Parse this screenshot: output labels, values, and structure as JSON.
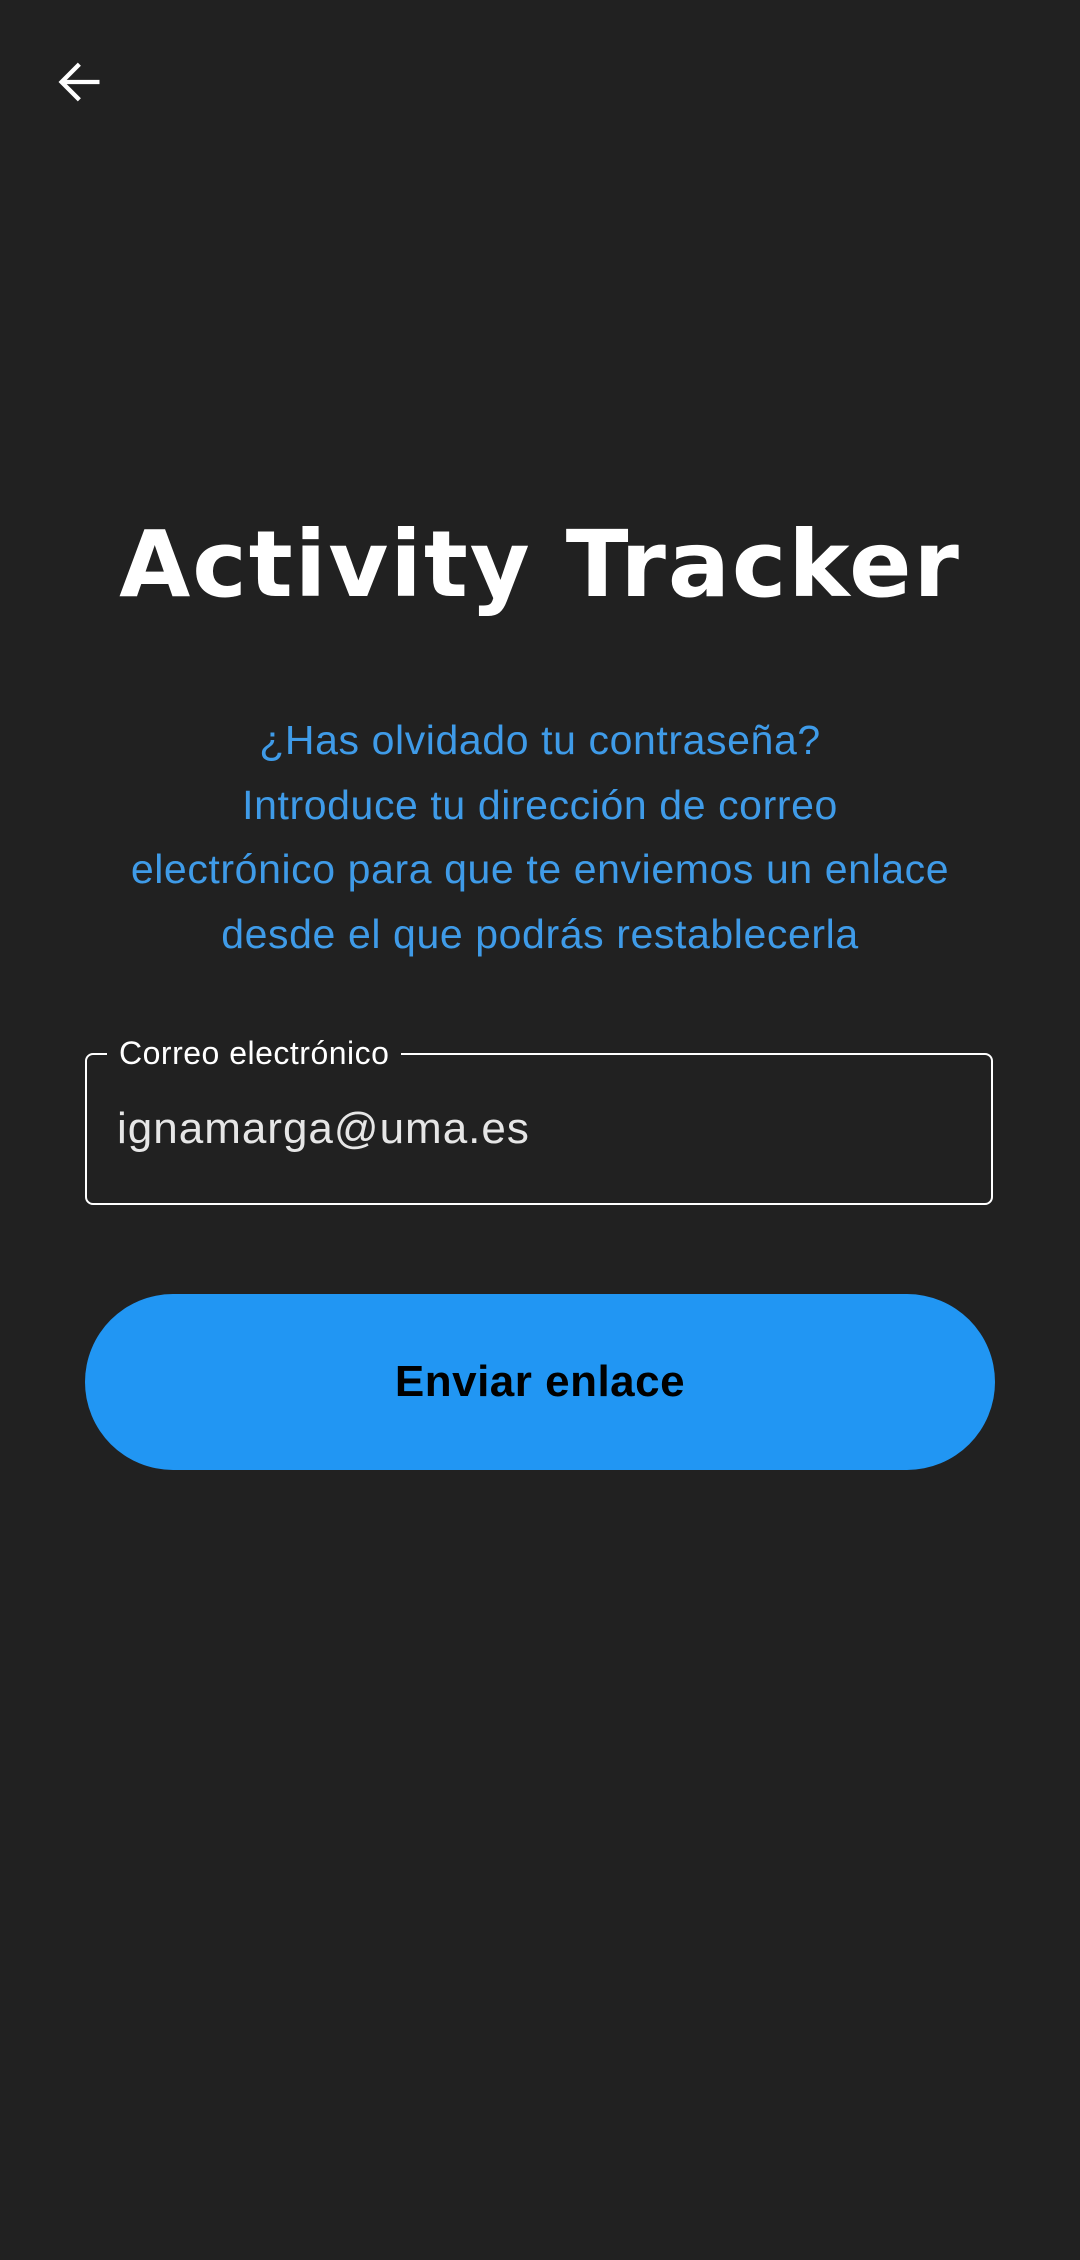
{
  "header": {
    "back_icon": "arrow-back-icon"
  },
  "app": {
    "title": "Activity Tracker"
  },
  "description": {
    "lines": [
      "¿Has olvidado tu contraseña?",
      "Introduce tu dirección de correo",
      "electrónico para que te enviemos un enlace",
      "desde el que podrás restablecerla"
    ]
  },
  "email_field": {
    "label": "Correo electrónico",
    "value": "ignamarga@uma.es"
  },
  "send_button": {
    "label": "Enviar enlace"
  },
  "colors": {
    "background": "#212121",
    "accent": "#2196f3",
    "description_text": "#3f9be8"
  }
}
